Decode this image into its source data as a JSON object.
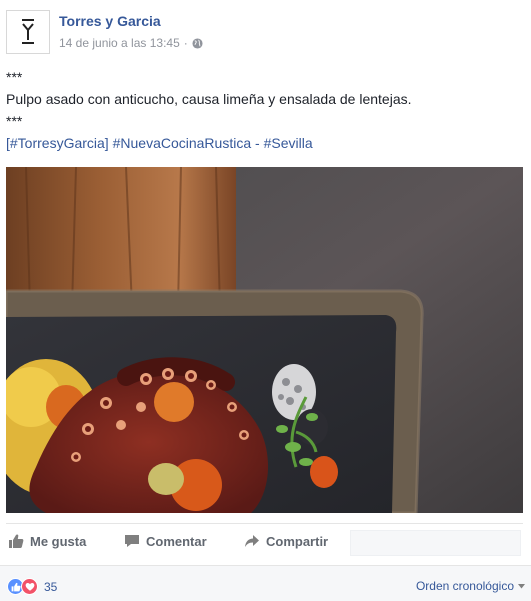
{
  "post": {
    "page_name": "Torres y Garcia",
    "timestamp": "14 de junio a las 13:45",
    "separator": "·",
    "privacy_icon": "globe-icon",
    "avatar_icon": "torres-y-garcia-logo"
  },
  "body": {
    "line1": "***",
    "line2": "Pulpo asado con anticucho, causa limeña y ensalada de lentejas.",
    "line3": "***",
    "hashtags": {
      "tag1": "[#TorresyGarcia]",
      "tag2": "#NuevaCocinaRustica",
      "sep": " - ",
      "tag3": "#Sevilla"
    }
  },
  "photo": {
    "subject": "plato de pulpo asado"
  },
  "actions": {
    "like": {
      "label": "Me gusta",
      "icon": "thumbs-up-icon"
    },
    "comment": {
      "label": "Comentar",
      "icon": "comment-icon"
    },
    "share": {
      "label": "Compartir",
      "icon": "share-icon"
    }
  },
  "footer": {
    "reaction_count": "35",
    "reaction_icons": [
      "like-reaction-icon",
      "love-reaction-icon"
    ],
    "order_label": "Orden cronológico",
    "order_icon": "caret-down-icon"
  },
  "colors": {
    "link": "#365899",
    "meta": "#90949c",
    "action": "#616770",
    "like_reaction": "#5890ff",
    "love_reaction": "#f25268"
  }
}
